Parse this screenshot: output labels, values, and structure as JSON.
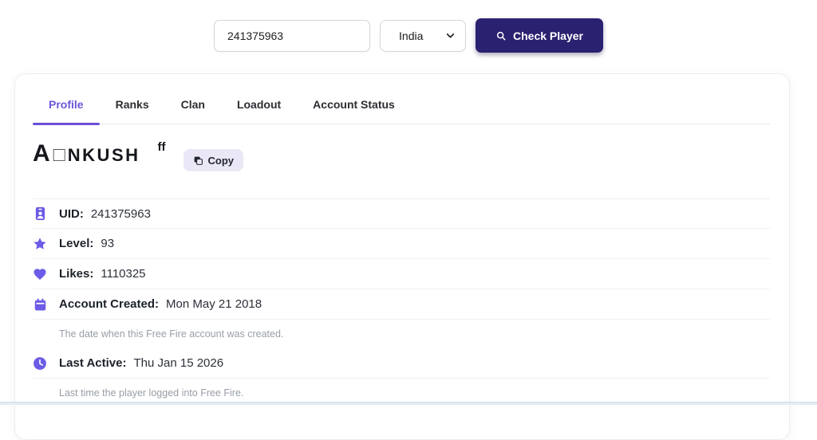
{
  "topbar": {
    "uid_input": {
      "value": "241375963"
    },
    "region_select": {
      "value": "India"
    },
    "check_button": {
      "label": "Check Player"
    }
  },
  "tabs": [
    {
      "label": "Profile",
      "active": true
    },
    {
      "label": "Ranks",
      "active": false
    },
    {
      "label": "Clan",
      "active": false
    },
    {
      "label": "Loadout",
      "active": false
    },
    {
      "label": "Account Status",
      "active": false
    }
  ],
  "player": {
    "name_first": "A",
    "name_box": "□",
    "name_rest": "NKUSH",
    "name_suffix": "ff",
    "copy_label": "Copy"
  },
  "profile": {
    "rows": [
      {
        "icon": "id-badge-icon",
        "label": "UID:",
        "value": "241375963"
      },
      {
        "icon": "star-icon",
        "label": "Level:",
        "value": "93"
      },
      {
        "icon": "heart-icon",
        "label": "Likes:",
        "value": "1110325"
      },
      {
        "icon": "calendar-icon",
        "label": "Account Created:",
        "value": "Mon May 21 2018",
        "description": "The date when this Free Fire account was created."
      },
      {
        "icon": "clock-icon",
        "label": "Last Active:",
        "value": "Thu Jan 15 2026",
        "description": "Last time the player logged into Free Fire."
      }
    ]
  },
  "colors": {
    "accent": "#6c5ce7",
    "tab_active": "#6d55d8",
    "button_bg": "#2a2170",
    "copy_bg": "#eae8f7"
  }
}
